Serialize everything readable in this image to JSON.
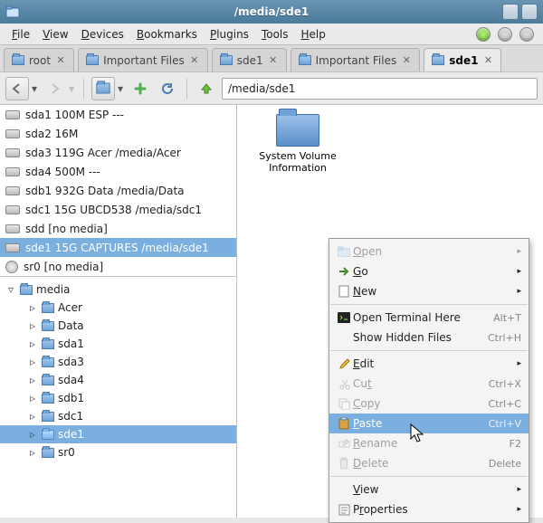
{
  "window": {
    "title": "/media/sde1"
  },
  "menus": {
    "file": "File",
    "view": "View",
    "devices": "Devices",
    "bookmarks": "Bookmarks",
    "plugins": "Plugins",
    "tools": "Tools",
    "help": "Help"
  },
  "tabs": [
    {
      "label": "root",
      "active": false
    },
    {
      "label": "Important Files",
      "active": false
    },
    {
      "label": "sde1",
      "active": false
    },
    {
      "label": "Important Files",
      "active": false
    },
    {
      "label": "sde1",
      "active": true
    }
  ],
  "address": "/media/sde1",
  "devices": [
    {
      "label": "sda1 100M ESP ---",
      "icon": "drive",
      "selected": false
    },
    {
      "label": "sda2 16M",
      "icon": "drive",
      "selected": false
    },
    {
      "label": "sda3 119G Acer /media/Acer",
      "icon": "drive",
      "selected": false
    },
    {
      "label": "sda4 500M ---",
      "icon": "drive",
      "selected": false
    },
    {
      "label": "sdb1 932G Data /media/Data",
      "icon": "drive",
      "selected": false
    },
    {
      "label": "sdc1 15G UBCD538 /media/sdc1",
      "icon": "drive",
      "selected": false
    },
    {
      "label": "sdd [no media]",
      "icon": "drive",
      "selected": false
    },
    {
      "label": "sde1 15G CAPTURES /media/sde1",
      "icon": "drive",
      "selected": true
    },
    {
      "label": "sr0 [no media]",
      "icon": "disc",
      "selected": false
    }
  ],
  "tree": {
    "root": "media",
    "children": [
      "Acer",
      "Data",
      "sda1",
      "sda3",
      "sda4",
      "sdb1",
      "sdc1",
      "sde1",
      "sr0"
    ],
    "selected": "sde1"
  },
  "files": [
    {
      "name": "System Volume Information"
    }
  ],
  "ctx": {
    "open": "Open",
    "go": "Go",
    "new": "New",
    "terminal": "Open Terminal Here",
    "terminal_accel": "Alt+T",
    "hidden": "Show Hidden Files",
    "hidden_accel": "Ctrl+H",
    "edit": "Edit",
    "cut": "Cut",
    "cut_accel": "Ctrl+X",
    "copy": "Copy",
    "copy_accel": "Ctrl+C",
    "paste": "Paste",
    "paste_accel": "Ctrl+V",
    "rename": "Rename",
    "rename_accel": "F2",
    "delete": "Delete",
    "delete_accel": "Delete",
    "view": "View",
    "properties": "Properties"
  }
}
